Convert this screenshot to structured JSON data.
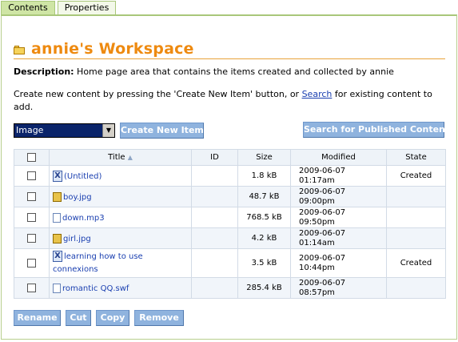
{
  "tabs": [
    {
      "label": "Contents",
      "active": true
    },
    {
      "label": "Properties",
      "active": false
    }
  ],
  "header": {
    "title": "annie's Workspace"
  },
  "description": {
    "label": "Description:",
    "text": "Home page area that contains the items created and collected by annie"
  },
  "instructions": {
    "before": "Create new content by pressing the 'Create New Item' button, or ",
    "link": "Search",
    "after": " for existing content to add."
  },
  "toolbar": {
    "type_select_value": "Image",
    "create_label": "Create New Item",
    "search_label": "Search for Published Content"
  },
  "table": {
    "headers": {
      "title": "Title",
      "id": "ID",
      "size": "Size",
      "modified": "Modified",
      "state": "State"
    },
    "rows": [
      {
        "icon": "document-icon",
        "title": "(Untitled)",
        "id": "",
        "size": "1.8 kB",
        "date": "2009-06-07",
        "time": "01:17am",
        "state": "Created"
      },
      {
        "icon": "image-file-icon",
        "title": "boy.jpg",
        "id": "",
        "size": "48.7 kB",
        "date": "2009-06-07",
        "time": "09:00pm",
        "state": ""
      },
      {
        "icon": "file-icon",
        "title": "down.mp3",
        "id": "",
        "size": "768.5 kB",
        "date": "2009-06-07",
        "time": "09:50pm",
        "state": ""
      },
      {
        "icon": "image-file-icon",
        "title": "girl.jpg",
        "id": "",
        "size": "4.2 kB",
        "date": "2009-06-07",
        "time": "01:14am",
        "state": ""
      },
      {
        "icon": "document-icon",
        "title": "learning how to use connexions",
        "id": "",
        "size": "3.5 kB",
        "date": "2009-06-07",
        "time": "10:44pm",
        "state": "Created"
      },
      {
        "icon": "file-icon",
        "title": "romantic QQ.swf",
        "id": "",
        "size": "285.4 kB",
        "date": "2009-06-07",
        "time": "08:57pm",
        "state": ""
      }
    ]
  },
  "actions": {
    "rename": "Rename",
    "cut": "Cut",
    "copy": "Copy",
    "remove": "Remove"
  }
}
